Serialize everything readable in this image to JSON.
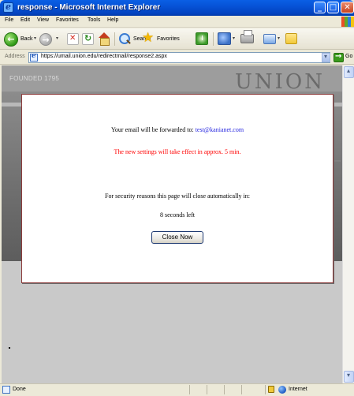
{
  "window": {
    "title": "response - Microsoft Internet Explorer",
    "minimize_glyph": "_",
    "maximize_glyph": "□",
    "close_glyph": "✕"
  },
  "menubar": {
    "items": [
      "File",
      "Edit",
      "View",
      "Favorites",
      "Tools",
      "Help"
    ]
  },
  "toolbar": {
    "back_label": "Back",
    "search_label": "Search",
    "favorites_label": "Favorites",
    "back_glyph": "←",
    "forward_glyph": "→",
    "icons": [
      "back-icon",
      "forward-icon",
      "stop-icon",
      "refresh-icon",
      "home-icon",
      "search-icon",
      "favorites-star-icon",
      "history-icon",
      "mail-icon",
      "print-icon",
      "edit-icon",
      "discuss-icon"
    ]
  },
  "address": {
    "label": "Address",
    "url": "https://umail.union.edu/redirectmail/response2.aspx",
    "go_label": "Go"
  },
  "page": {
    "founded": "FOUNDED 1795",
    "logo": "UNION",
    "forward_prefix": "Your email will be forwarded to: ",
    "forward_email": "test@kanianet.com",
    "settings_notice": "The new settings will take effect in approx. 5 min.",
    "security_notice": "For security reasons this page will close automatically in:",
    "countdown": "8 seconds left",
    "close_button": "Close Now"
  },
  "statusbar": {
    "status": "Done",
    "zone": "Internet"
  },
  "colors": {
    "title_blue": "#0652d6",
    "link_blue": "#2727e0",
    "notice_red": "#ff0000",
    "dialog_border": "#8c3a3a"
  }
}
